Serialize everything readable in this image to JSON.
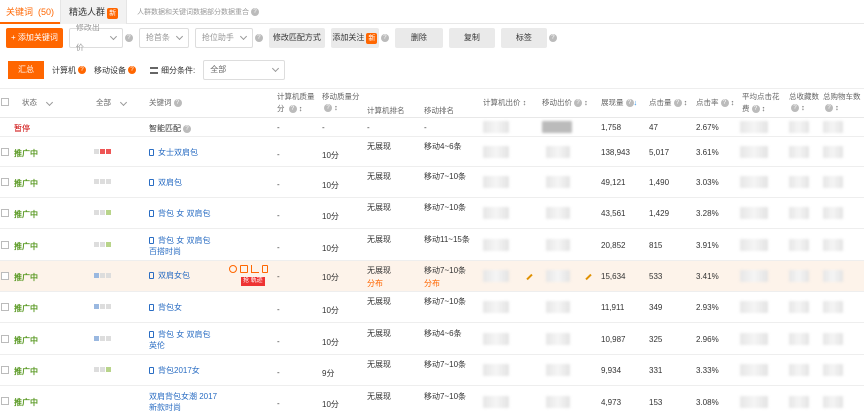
{
  "tabs": {
    "keywords": "关键词",
    "keywords_count": "(50)",
    "crowd": "精选人群",
    "crowd_badge": "新",
    "note": "人群数据和关键词数据部分数据重合"
  },
  "toolbar": {
    "add_keyword": "+ 添加关键词",
    "modify_bid": "修改出价",
    "rank_assist": "抢首条",
    "position_assist": "抢位助手",
    "modify_match": "修改匹配方式",
    "add_follow": "添加关注",
    "follow_badge": "新",
    "delete": "删除",
    "copy": "复制",
    "tag": "标签"
  },
  "filters": {
    "summary": "汇总",
    "computer": "计算机",
    "mobile": "移动设备",
    "segment_label": "细分条件:",
    "segment_value": "全部"
  },
  "headers": {
    "status": "状态",
    "all": "全部",
    "keyword": "关键词",
    "pc_quality": "计算机质量",
    "pc_quality2": "分",
    "mobile_quality": "移动质量分",
    "pc_rank": "计算机排名",
    "mobile_rank": "移动排名",
    "pc_bid": "计算机出价",
    "mobile_bid": "移动出价",
    "impressions": "展现量",
    "clicks": "点击量",
    "ctr": "点击率",
    "avg_cost1": "平均点击花",
    "avg_cost2": "费",
    "favorites": "总收藏数",
    "cart": "总购物车数"
  },
  "rows": [
    {
      "status": "暂停",
      "keyword": "智能匹配",
      "pcq": "-",
      "mq": "-",
      "pcr": "-",
      "mr": "-",
      "imp": "1,758",
      "clk": "47",
      "ctr": "2.67%"
    },
    {
      "status": "推广中",
      "keyword": "女士双肩包",
      "pcq": "-",
      "mq": "10分",
      "pcr": "无展现",
      "mr": "移动4~6条",
      "imp": "138,943",
      "clk": "5,017",
      "ctr": "3.61%"
    },
    {
      "status": "推广中",
      "keyword": "双肩包",
      "pcq": "-",
      "mq": "10分",
      "pcr": "无展现",
      "mr": "移动7~10条",
      "imp": "49,121",
      "clk": "1,490",
      "ctr": "3.03%"
    },
    {
      "status": "推广中",
      "keyword": "背包 女 双肩包",
      "pcq": "-",
      "mq": "10分",
      "pcr": "无展现",
      "mr": "移动7~10条",
      "imp": "43,561",
      "clk": "1,429",
      "ctr": "3.28%"
    },
    {
      "status": "推广中",
      "keyword": "背包 女 双肩包",
      "keyword2": "百搭时尚",
      "pcq": "-",
      "mq": "10分",
      "pcr": "无展现",
      "mr": "移动11~15条",
      "imp": "20,852",
      "clk": "815",
      "ctr": "3.91%"
    },
    {
      "status": "推广中",
      "keyword": "双肩女包",
      "pcq": "-",
      "mq": "10分",
      "pcr": "无展现",
      "pcr2": "分布",
      "mr": "移动7~10条",
      "mr2": "分布",
      "imp": "15,634",
      "clk": "533",
      "ctr": "3.41%",
      "badge": "抢 軌迹"
    },
    {
      "status": "推广中",
      "keyword": "背包女",
      "pcq": "-",
      "mq": "10分",
      "pcr": "无展现",
      "mr": "移动7~10条",
      "imp": "11,911",
      "clk": "349",
      "ctr": "2.93%"
    },
    {
      "status": "推广中",
      "keyword": "背包 女 双肩包",
      "keyword2": "英伦",
      "pcq": "-",
      "mq": "10分",
      "pcr": "无展现",
      "mr": "移动4~6条",
      "imp": "10,987",
      "clk": "325",
      "ctr": "2.96%"
    },
    {
      "status": "推广中",
      "keyword": "背包2017女",
      "pcq": "-",
      "mq": "9分",
      "pcr": "无展现",
      "mr": "移动7~10条",
      "imp": "9,934",
      "clk": "331",
      "ctr": "3.33%"
    },
    {
      "status": "推广中",
      "keyword": "双肩背包女潮 2017",
      "keyword2": "新款时尚",
      "pcq": "-",
      "mq": "10分",
      "pcr": "无展现",
      "mr": "移动7~10条",
      "imp": "4,973",
      "clk": "153",
      "ctr": "3.08%"
    }
  ],
  "colors": {
    "accent": "#ff6600",
    "active_green": "#5b9a25",
    "link_blue": "#2a6dc3"
  }
}
